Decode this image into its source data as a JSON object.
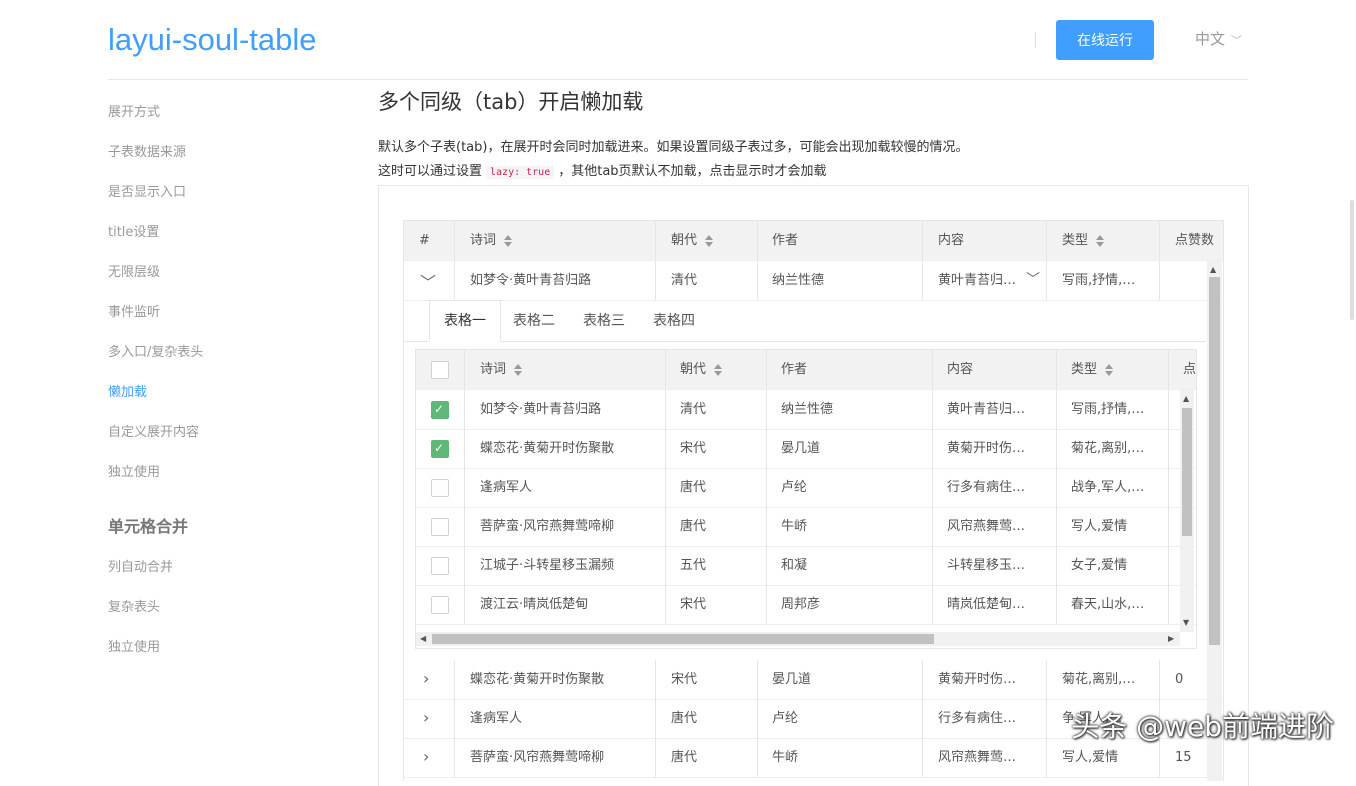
{
  "header": {
    "logo": "layui-soul-table",
    "run_button": "在线运行",
    "language": "中文"
  },
  "sidebar": {
    "items": [
      {
        "label": "展开方式"
      },
      {
        "label": "子表数据来源"
      },
      {
        "label": "是否显示入口"
      },
      {
        "label": "title设置"
      },
      {
        "label": "无限层级"
      },
      {
        "label": "事件监听"
      },
      {
        "label": "多入口/复杂表头"
      },
      {
        "label": "懒加载",
        "active": true
      },
      {
        "label": "自定义展开内容"
      },
      {
        "label": "独立使用"
      }
    ],
    "group_title": "单元格合并",
    "group_items": [
      {
        "label": "列自动合并"
      },
      {
        "label": "复杂表头"
      },
      {
        "label": "独立使用"
      }
    ]
  },
  "content": {
    "title": "多个同级（tab）开启懒加载",
    "desc1": "默认多个子表(tab)，在展开时会同时加载进来。如果设置同级子表过多，可能会出现加载较慢的情况。",
    "desc2_pre": "这时可以通过设置",
    "desc2_code": "lazy: true",
    "desc2_post": "，其他tab页默认不加载，点击显示时才会加载"
  },
  "outer_table": {
    "headers": [
      "#",
      "诗词",
      "朝代",
      "作者",
      "内容",
      "类型",
      "点赞数"
    ],
    "expanded_row": {
      "poem": "如梦令·黄叶青苔归路",
      "dynasty": "清代",
      "author": "纳兰性德",
      "content": "黄叶青苔归…",
      "type": "写雨,抒情,…",
      "likes": ""
    },
    "rows": [
      {
        "poem": "蝶恋花·黄菊开时伤聚散",
        "dynasty": "宋代",
        "author": "晏几道",
        "content": "黄菊开时伤…",
        "type": "菊花,离别,…",
        "likes": "0"
      },
      {
        "poem": "逢病军人",
        "dynasty": "唐代",
        "author": "卢纶",
        "content": "行多有病住…",
        "type": "争,军人,…",
        "likes": ""
      },
      {
        "poem": "菩萨蛮·风帘燕舞莺啼柳",
        "dynasty": "唐代",
        "author": "牛峤",
        "content": "风帘燕舞莺…",
        "type": "写人,爱情",
        "likes": "15"
      }
    ]
  },
  "tabs": [
    "表格一",
    "表格二",
    "表格三",
    "表格四"
  ],
  "inner_table": {
    "headers": [
      "诗词",
      "朝代",
      "作者",
      "内容",
      "类型",
      "点"
    ],
    "rows": [
      {
        "checked": true,
        "poem": "如梦令·黄叶青苔归路",
        "dynasty": "清代",
        "author": "纳兰性德",
        "content": "黄叶青苔归…",
        "type": "写雨,抒情,…"
      },
      {
        "checked": true,
        "poem": "蝶恋花·黄菊开时伤聚散",
        "dynasty": "宋代",
        "author": "晏几道",
        "content": "黄菊开时伤…",
        "type": "菊花,离别,…"
      },
      {
        "checked": false,
        "poem": "逢病军人",
        "dynasty": "唐代",
        "author": "卢纶",
        "content": "行多有病住…",
        "type": "战争,军人,…"
      },
      {
        "checked": false,
        "poem": "菩萨蛮·风帘燕舞莺啼柳",
        "dynasty": "唐代",
        "author": "牛峤",
        "content": "风帘燕舞莺…",
        "type": "写人,爱情"
      },
      {
        "checked": false,
        "poem": "江城子·斗转星移玉漏频",
        "dynasty": "五代",
        "author": "和凝",
        "content": "斗转星移玉…",
        "type": "女子,爱情"
      },
      {
        "checked": false,
        "poem": "渡江云·晴岚低楚甸",
        "dynasty": "宋代",
        "author": "周邦彦",
        "content": "晴岚低楚甸…",
        "type": "春天,山水,…"
      }
    ]
  },
  "watermark": "头条 @web前端进阶",
  "colors": {
    "accent": "#409eff",
    "checkbox": "#5fb878"
  }
}
